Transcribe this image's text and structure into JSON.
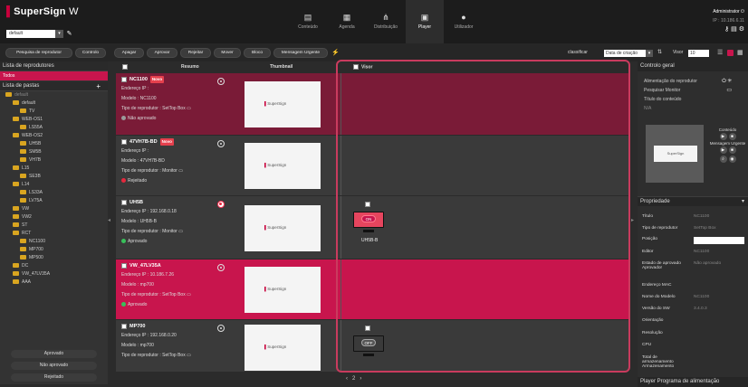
{
  "app": {
    "logo_text": "SuperSign",
    "logo_suffix": "W",
    "group": "default"
  },
  "nav": [
    {
      "label": "Conteúdo",
      "icon": "content-icon"
    },
    {
      "label": "Agenda",
      "icon": "calendar-icon"
    },
    {
      "label": "Distribuição",
      "icon": "distribution-icon"
    },
    {
      "label": "Player",
      "icon": "player-icon"
    },
    {
      "label": "Utilizador",
      "icon": "user-icon"
    }
  ],
  "admin": {
    "name": "Administrator",
    "ip": "IP : 10.186.6.11"
  },
  "toolbar": {
    "left_buttons": [
      "Pesquisa de reprodutor",
      "Controlo"
    ],
    "buttons": [
      "Apagar",
      "Aprovar",
      "Rejeitar",
      "Mover",
      "Bloco",
      "Mensagem Urgente"
    ],
    "sort_label": "classificar",
    "sort_value": "Data de criação",
    "view_label": "Visor",
    "view_value": "10"
  },
  "left": {
    "title": "Lista de reprodutores",
    "all": "Todos",
    "folders_title": "Lista de pastas",
    "tree": [
      "default",
      "default",
      "TV",
      "WEB-OS1",
      "LS55A",
      "WEB-OS2",
      "UH5B",
      "SM5B",
      "VH7B",
      "L15",
      "SE3B",
      "L14",
      "LS33A",
      "LV75A",
      "VW",
      "VW2",
      "ST",
      "RCT",
      "NC1100",
      "MP700",
      "MP500",
      "DC",
      "VW_47LV35A",
      "AAA"
    ],
    "buttons": [
      "Aprovado",
      "Não aprovado",
      "Rejeitado"
    ]
  },
  "columns": {
    "summary": "Resumo",
    "thumbnail": "Thumbnail",
    "viewer": "Visor"
  },
  "players": [
    {
      "name": "NC1100",
      "is_new": true,
      "new_label": "Novo",
      "ip_label": "Endereço IP :",
      "ip": "",
      "model_label": "Modelo :",
      "model": "NC1100",
      "type_label": "Tipo de reprodutor :",
      "type": "SetTop Box",
      "status": "Não aprovado",
      "status_color": "#9a9a9a"
    },
    {
      "name": "47VH7B-BD",
      "is_new": true,
      "new_label": "Novo",
      "ip_label": "Endereço IP :",
      "ip": "",
      "model_label": "Modelo :",
      "model": "47VH7B-BD",
      "type_label": "Tipo de reprodutor :",
      "type": "Monitor",
      "status": "Rejeitado",
      "status_color": "#e5283d"
    },
    {
      "name": "UH5B",
      "is_new": false,
      "ip_label": "Endereço IP :",
      "ip": "192.168.0.18",
      "model_label": "Modelo :",
      "model": "UH5B-B",
      "type_label": "Tipo de reprodutor :",
      "type": "Monitor",
      "status": "Aprovado",
      "status_color": "#38c05a",
      "viewer_state": "ON",
      "viewer_label": "UH5B-B"
    },
    {
      "name": "VW_47LV35A",
      "is_new": false,
      "ip_label": "Endereço IP :",
      "ip": "10.186.7.26",
      "model_label": "Modelo :",
      "model": "mp700",
      "type_label": "Tipo de reprodutor :",
      "type": "SetTop Box",
      "status": "Aprovado",
      "status_color": "#38c05a"
    },
    {
      "name": "MP700",
      "is_new": false,
      "ip_label": "Endereço IP :",
      "ip": "192.168.0.20",
      "model_label": "Modelo :",
      "model": "mp700",
      "type_label": "Tipo de reprodutor :",
      "type": "SetTop Box",
      "status": "",
      "status_color": "#38c05a",
      "viewer_state": "OFF"
    }
  ],
  "thumbnail_text": "SuperSign",
  "pager": {
    "page": "2"
  },
  "right": {
    "control_title": "Controlo geral",
    "controls": [
      "Alimentação do reprodutor",
      "Pesquisar Monitor",
      "Título do conteúdo"
    ],
    "content_title_value": "N/A",
    "content_label": "Conteúdo",
    "urgent_label": "Mensagem Urgente",
    "props_title": "Propriedade",
    "props": [
      {
        "k": "Título",
        "v": "NC1100"
      },
      {
        "k": "Tipo de reprodutor",
        "v": "SetTop Box"
      },
      {
        "k": "Posição",
        "v": ""
      },
      {
        "k": "Editor",
        "v": "NC1100"
      },
      {
        "k": "Estado de aprovado Aprovador",
        "v": "Não aprovado"
      },
      {
        "k": "Endereço MAC",
        "v": ""
      },
      {
        "k": "Nome do Modelo",
        "v": "NC1100"
      },
      {
        "k": "Versão do SW",
        "v": "3.4.0.3"
      },
      {
        "k": "Orientação",
        "v": ""
      },
      {
        "k": "Resolução",
        "v": ""
      },
      {
        "k": "CPU",
        "v": ""
      },
      {
        "k": "Total de armazenamento Armazenamento",
        "v": ""
      }
    ],
    "footer": "Player Programa de alimentação"
  },
  "colors": {
    "accent": "#c8154d",
    "selected_row": "#7a1b37",
    "viewer_frame": "#c93b5e"
  }
}
